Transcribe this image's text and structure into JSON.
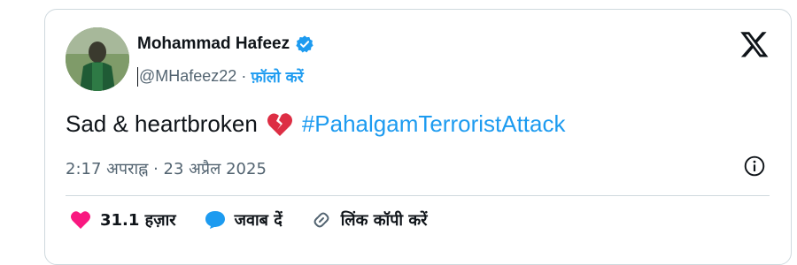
{
  "author": {
    "name": "Mohammad Hafeez",
    "handle": "@MHafeez22",
    "separator": "·",
    "follow_label": "फ़ॉलो करें"
  },
  "tweet": {
    "text": "Sad & heartbroken",
    "hashtag": "#PahalgamTerroristAttack",
    "emoji": "broken-heart-icon"
  },
  "meta": {
    "time": "2:17 अपराह्न",
    "separator": "·",
    "date": "23 अप्रैल 2025"
  },
  "actions": {
    "likes": "31.1 हज़ार",
    "reply": "जवाब दें",
    "copy_link": "लिंक कॉपी करें"
  },
  "colors": {
    "accent": "#1d9bf0",
    "like": "#f91880",
    "text": "#0f1419",
    "muted": "#536471",
    "border": "#cfd9de"
  }
}
